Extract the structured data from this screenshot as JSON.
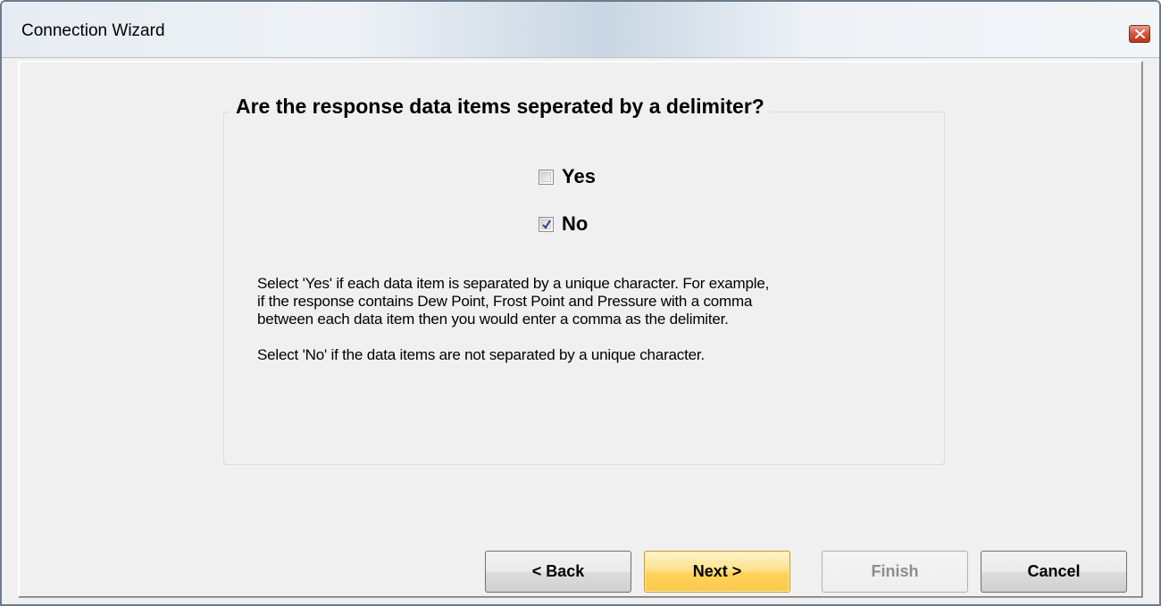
{
  "window": {
    "title": "Connection Wizard"
  },
  "group": {
    "legend": "Are the response data items seperated by a delimiter?"
  },
  "options": [
    {
      "label": "Yes",
      "checked": false
    },
    {
      "label": "No",
      "checked": true
    }
  ],
  "help": {
    "line1": "Select 'Yes' if each data item is separated by a unique character.  For example,",
    "line2": "if the response contains Dew Point, Frost Point and Pressure with a comma",
    "line3": "between each data item then you would enter a comma as the delimiter.",
    "line4": "Select 'No' if the data items are not separated by a unique character."
  },
  "buttons": {
    "back": "< Back",
    "next": "Next >",
    "finish": "Finish",
    "cancel": "Cancel"
  },
  "colors": {
    "next_accent": "#ffd35a",
    "close_accent": "#c0341c"
  },
  "icons": {
    "close": "close-icon",
    "check": "checkmark-icon"
  }
}
